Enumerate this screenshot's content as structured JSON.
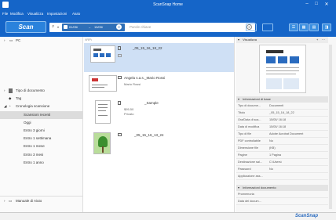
{
  "window": {
    "title": "ScanSnap Home",
    "minimize": "–",
    "maximize": "□",
    "close": "✕"
  },
  "menu": [
    "File",
    "Modifica",
    "Visualizza",
    "Impostazioni",
    "Aiuto"
  ],
  "toolbar": {
    "scan_label": "Scan",
    "date_from": "01/05/",
    "date_to": "15/05/",
    "search_placeholder": "Parole chiave"
  },
  "left_nav": {
    "pc_label": "PC",
    "items": [
      {
        "label": "Tipo di documento",
        "icon": "document-type-icon"
      },
      {
        "label": "Tag",
        "icon": "tag-icon"
      },
      {
        "label": "Cronologia scansione",
        "icon": "history-icon"
      }
    ],
    "history_items": [
      "Scansioni recenti",
      "Oggi",
      "Entro 3 giorni",
      "Entro 1 settimana",
      "Entro 1 mese",
      "Entro 3 mesi",
      "Entro 1 anno"
    ],
    "selected_history": "Scansioni recenti",
    "footer_link": "Manuale di Aiuto"
  },
  "content": {
    "path_label": "\\\\RP\\",
    "docs": [
      {
        "name": "_05_15_16_18_22",
        "sub": "",
        "type": "document"
      },
      {
        "name": "Angela s.a.s._Mario Rossi",
        "sub": "Mario Rossi",
        "type": "card"
      },
      {
        "name": "_Sample",
        "sub": "$95.50",
        "sub2": "Privato",
        "type": "receipt"
      },
      {
        "name": "_05_15_16_13_24",
        "sub": "",
        "type": "photo"
      }
    ]
  },
  "preview": {
    "header": "Visualizza",
    "info_header": "Informazioni di base",
    "properties": [
      {
        "key": "Tipo di docume...",
        "value": "Documenti"
      },
      {
        "key": "Titolo",
        "value": "_05_15_16_18_22"
      },
      {
        "key": "Ora/Data di sca...",
        "value": "15/05/ 16:18"
      },
      {
        "key": "Data di modifica",
        "value": "15/05/ 16:18"
      },
      {
        "key": "Tipo di file",
        "value": "Adobe Acrobat Document"
      },
      {
        "key": "PDF controllabile",
        "value": "No"
      },
      {
        "key": "Dimensione file",
        "value": "(KB)"
      },
      {
        "key": "Pagine",
        "value": "1 Pagina"
      },
      {
        "key": "Destinazione sal...",
        "value": "C:\\Users\\"
      },
      {
        "key": "Password",
        "value": "No"
      },
      {
        "key": "Applicazione ass...",
        "value": ""
      }
    ],
    "doc_info_header": "Informazioni documento",
    "doc_info": [
      {
        "key": "Promemoria",
        "value": ""
      },
      {
        "key": "Data del docum...",
        "value": ""
      }
    ]
  },
  "brand": {
    "logo": "ScanSnap",
    "accent": "#1565c8"
  }
}
